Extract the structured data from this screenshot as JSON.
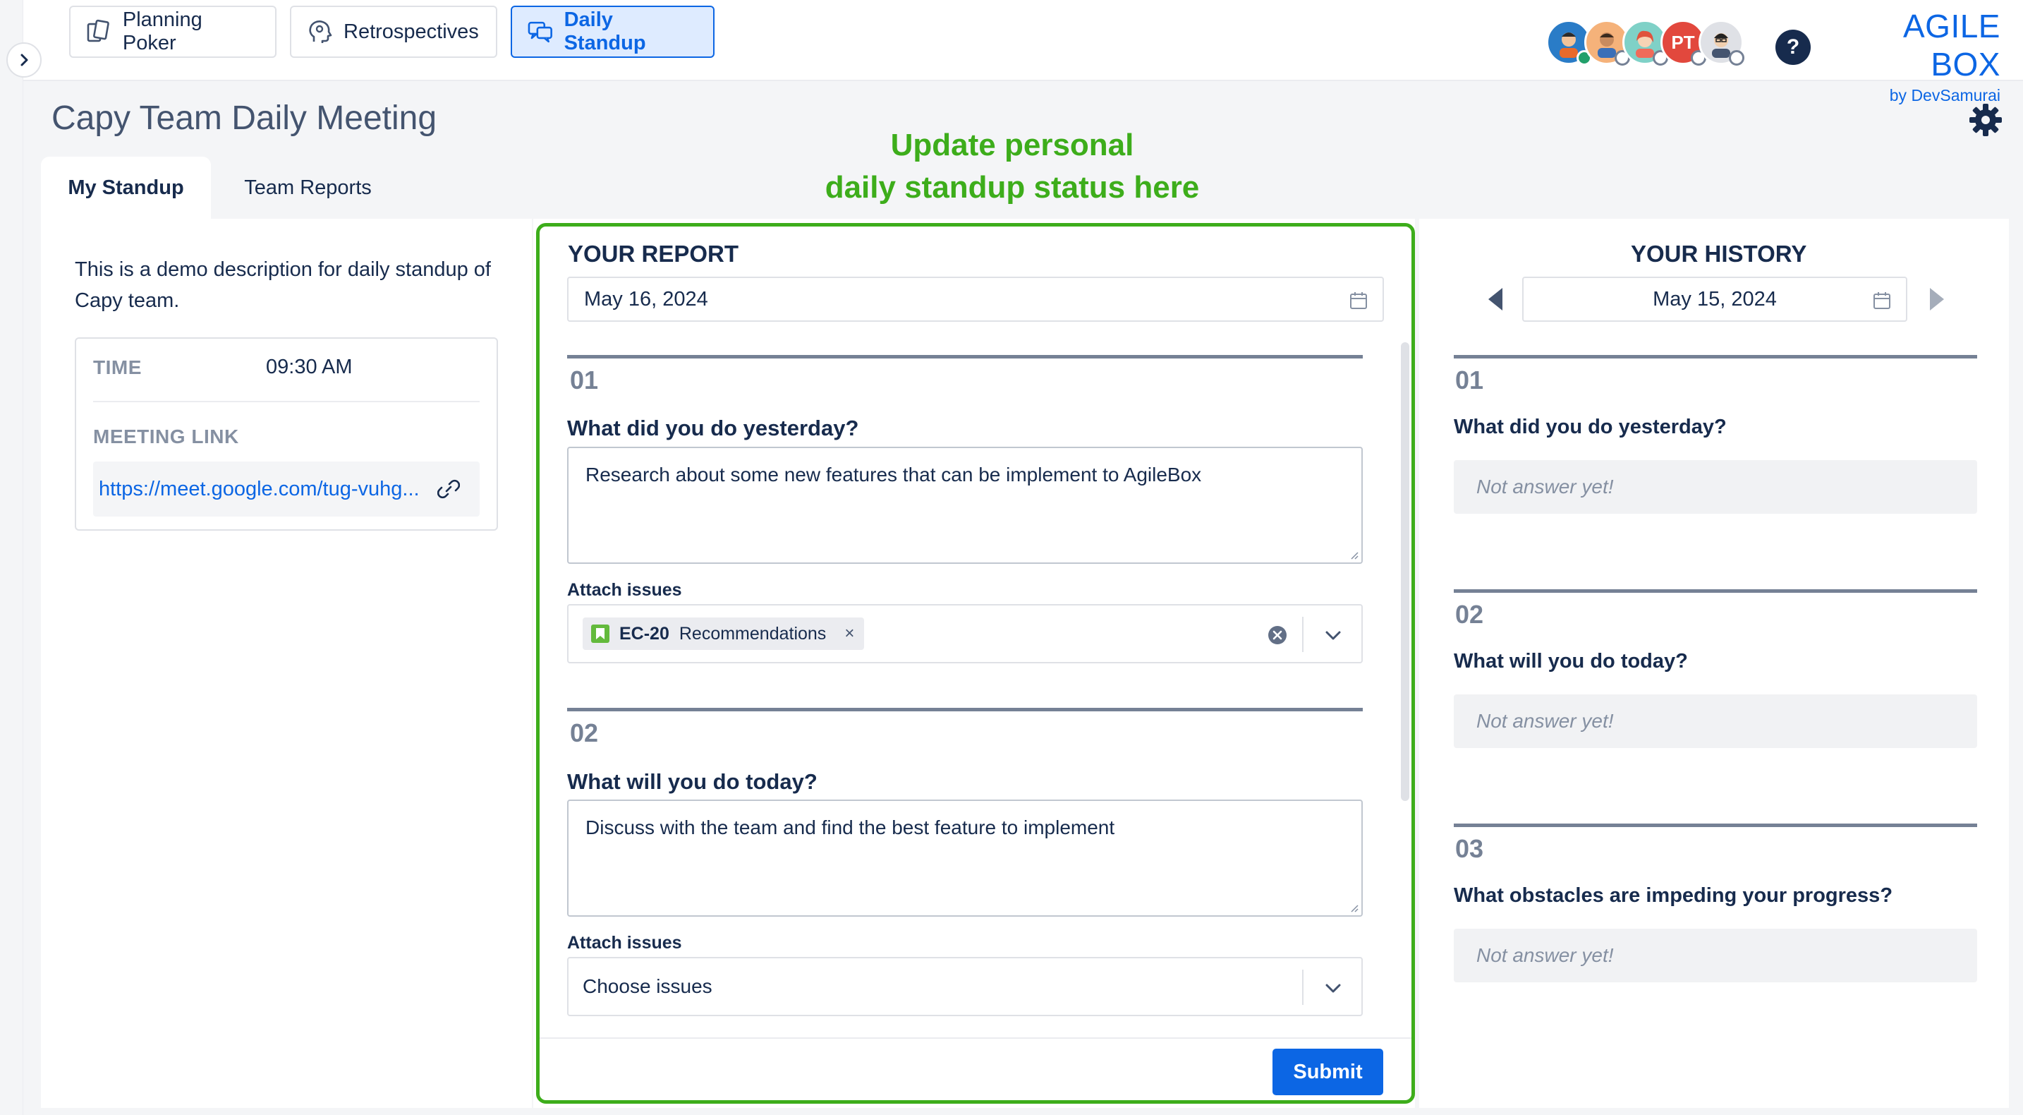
{
  "nav": {
    "buttons": [
      {
        "label": "Planning Poker",
        "icon": "cards-icon"
      },
      {
        "label": "Retrospectives",
        "icon": "head-icon"
      },
      {
        "label": "Daily Standup",
        "icon": "chat-icon"
      }
    ],
    "help_label": "?",
    "avatar_initials": "PT",
    "brand_title": "AGILE BOX",
    "brand_subtitle": "by DevSamurai"
  },
  "page": {
    "title": "Capy Team Daily Meeting",
    "annotation_line1": "Update personal",
    "annotation_line2": "daily standup status here"
  },
  "tabs": [
    {
      "label": "My Standup",
      "active": true
    },
    {
      "label": "Team Reports",
      "active": false
    }
  ],
  "left": {
    "description": "This is a demo description for daily standup of Capy team.",
    "time_label": "TIME",
    "time_value": "09:30 AM",
    "link_label": "MEETING LINK",
    "link_value": "https://meet.google.com/tug-vuhg..."
  },
  "report": {
    "heading": "YOUR REPORT",
    "date": "May 16, 2024",
    "questions": [
      {
        "number": "01",
        "text": "What did you do yesterday?",
        "answer": "Research about some new features that can be implement to AgileBox",
        "attach_label": "Attach issues",
        "issue_key": "EC-20",
        "issue_title": "Recommendations",
        "remove_label": "×"
      },
      {
        "number": "02",
        "text": "What will you do today?",
        "answer": "Discuss with the team and find the best feature to implement",
        "attach_label": "Attach issues",
        "placeholder": "Choose issues"
      }
    ],
    "submit_label": "Submit"
  },
  "history": {
    "heading": "YOUR HISTORY",
    "date": "May 15, 2024",
    "items": [
      {
        "number": "01",
        "text": "What did you do yesterday?",
        "answer": "Not answer yet!"
      },
      {
        "number": "02",
        "text": "What will you do today?",
        "answer": "Not answer yet!"
      },
      {
        "number": "03",
        "text": "What obstacles are impeding your progress?",
        "answer": "Not answer yet!"
      }
    ]
  },
  "colors": {
    "accent": "#0c66e4",
    "highlight": "#3dad1b",
    "story": "#63ba3c"
  }
}
